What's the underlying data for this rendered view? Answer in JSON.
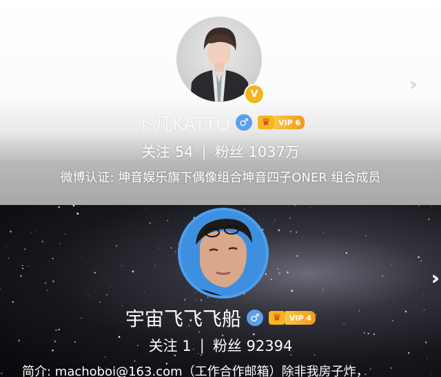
{
  "profile_top": {
    "name": "卜凡KATTO",
    "vip_label": "VIP 6",
    "verified_icon": "v-verified-badge",
    "gender_icon": "male-icon",
    "stats": {
      "following_label": "关注",
      "following_count": "54",
      "divider": "|",
      "fans_label": "粉丝",
      "fans_count": "1037万"
    },
    "certification": "微博认证: 坤音娱乐旗下偶像组合坤音四子ONER 组合成员",
    "colors": {
      "gold_badge": "#f2b51e",
      "gender_blue": "#5aa0ea"
    }
  },
  "profile_bottom": {
    "name": "宇宙飞飞飞船",
    "vip_label": "VIP 4",
    "gender_icon": "male-icon",
    "stats": {
      "following_label": "关注",
      "following_count": "1",
      "divider": "|",
      "fans_label": "粉丝",
      "fans_count": "92394"
    },
    "intro": "简介: machoboi@163.com（工作合作邮箱）除非我房子炸，",
    "colors": {
      "avatar_ring": "#4ea0f0"
    }
  },
  "icons": {
    "more": "chevron-right-triple-icon",
    "vip_crown": "crown-icon"
  }
}
